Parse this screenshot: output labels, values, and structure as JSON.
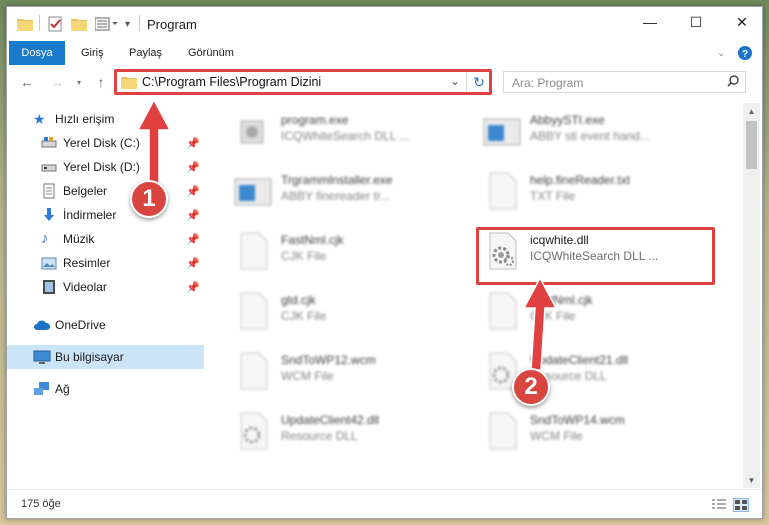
{
  "window": {
    "title": "Program",
    "buttons": {
      "minimize": "—",
      "maximize": "☐",
      "close": "✕"
    }
  },
  "ribbon": {
    "tabs": [
      {
        "label": "Dosya",
        "active": true
      },
      {
        "label": "Giriş"
      },
      {
        "label": "Paylaş"
      },
      {
        "label": "Görünüm"
      }
    ]
  },
  "nav": {
    "address": "C:\\Program Files\\Program Dizini",
    "search_placeholder": "Ara: Program"
  },
  "sidebar": {
    "quick_access": "Hızlı erişim",
    "items": [
      {
        "label": "Yerel Disk (C:)",
        "icon": "drive-icon",
        "pinned": true
      },
      {
        "label": "Yerel Disk (D:)",
        "icon": "drive-icon",
        "pinned": true
      },
      {
        "label": "Belgeler",
        "icon": "documents-icon",
        "pinned": true
      },
      {
        "label": "İndirmeler",
        "icon": "downloads-icon",
        "pinned": true
      },
      {
        "label": "Müzik",
        "icon": "music-icon",
        "pinned": true
      },
      {
        "label": "Resimler",
        "icon": "pictures-icon",
        "pinned": true
      },
      {
        "label": "Videolar",
        "icon": "videos-icon",
        "pinned": true
      }
    ],
    "onedrive": "OneDrive",
    "this_pc": "Bu bilgisayar",
    "network": "Ağ"
  },
  "files": [
    {
      "name": "program.exe",
      "sub": "ICQWhiteSearch DLL ...",
      "kind": "exe"
    },
    {
      "name": "AbbyySTI.exe",
      "sub": "ABBY sti event hand...",
      "kind": "exe-window"
    },
    {
      "name": "Trgrammlnstaller.exe",
      "sub": "ABBY finereader tr...",
      "kind": "exe-window"
    },
    {
      "name": "help.fineReader.txt",
      "sub": "TXT File",
      "kind": "txt"
    },
    {
      "name": "FastNml.cjk",
      "sub": "CJK File",
      "kind": "doc"
    },
    {
      "name": "icqwhite.dll",
      "sub": "ICQWhiteSearch DLL ...",
      "kind": "dll"
    },
    {
      "name": "gtd.cjk",
      "sub": "CJK File",
      "kind": "doc"
    },
    {
      "name": "FastNml.cjk",
      "sub": "CJK File",
      "kind": "doc"
    },
    {
      "name": "SndToWP12.wcm",
      "sub": "WCM File",
      "kind": "doc"
    },
    {
      "name": "UpdateClient21.dll",
      "sub": "Resource DLL",
      "kind": "dll"
    },
    {
      "name": "UpdateClient42.dll",
      "sub": "Resource DLL",
      "kind": "dll"
    },
    {
      "name": "SndToWP14.wcm",
      "sub": "WCM File",
      "kind": "doc"
    }
  ],
  "status": {
    "count": "175 öğe"
  },
  "annotations": {
    "step1": "1",
    "step2": "2",
    "accent": "#e04040"
  }
}
